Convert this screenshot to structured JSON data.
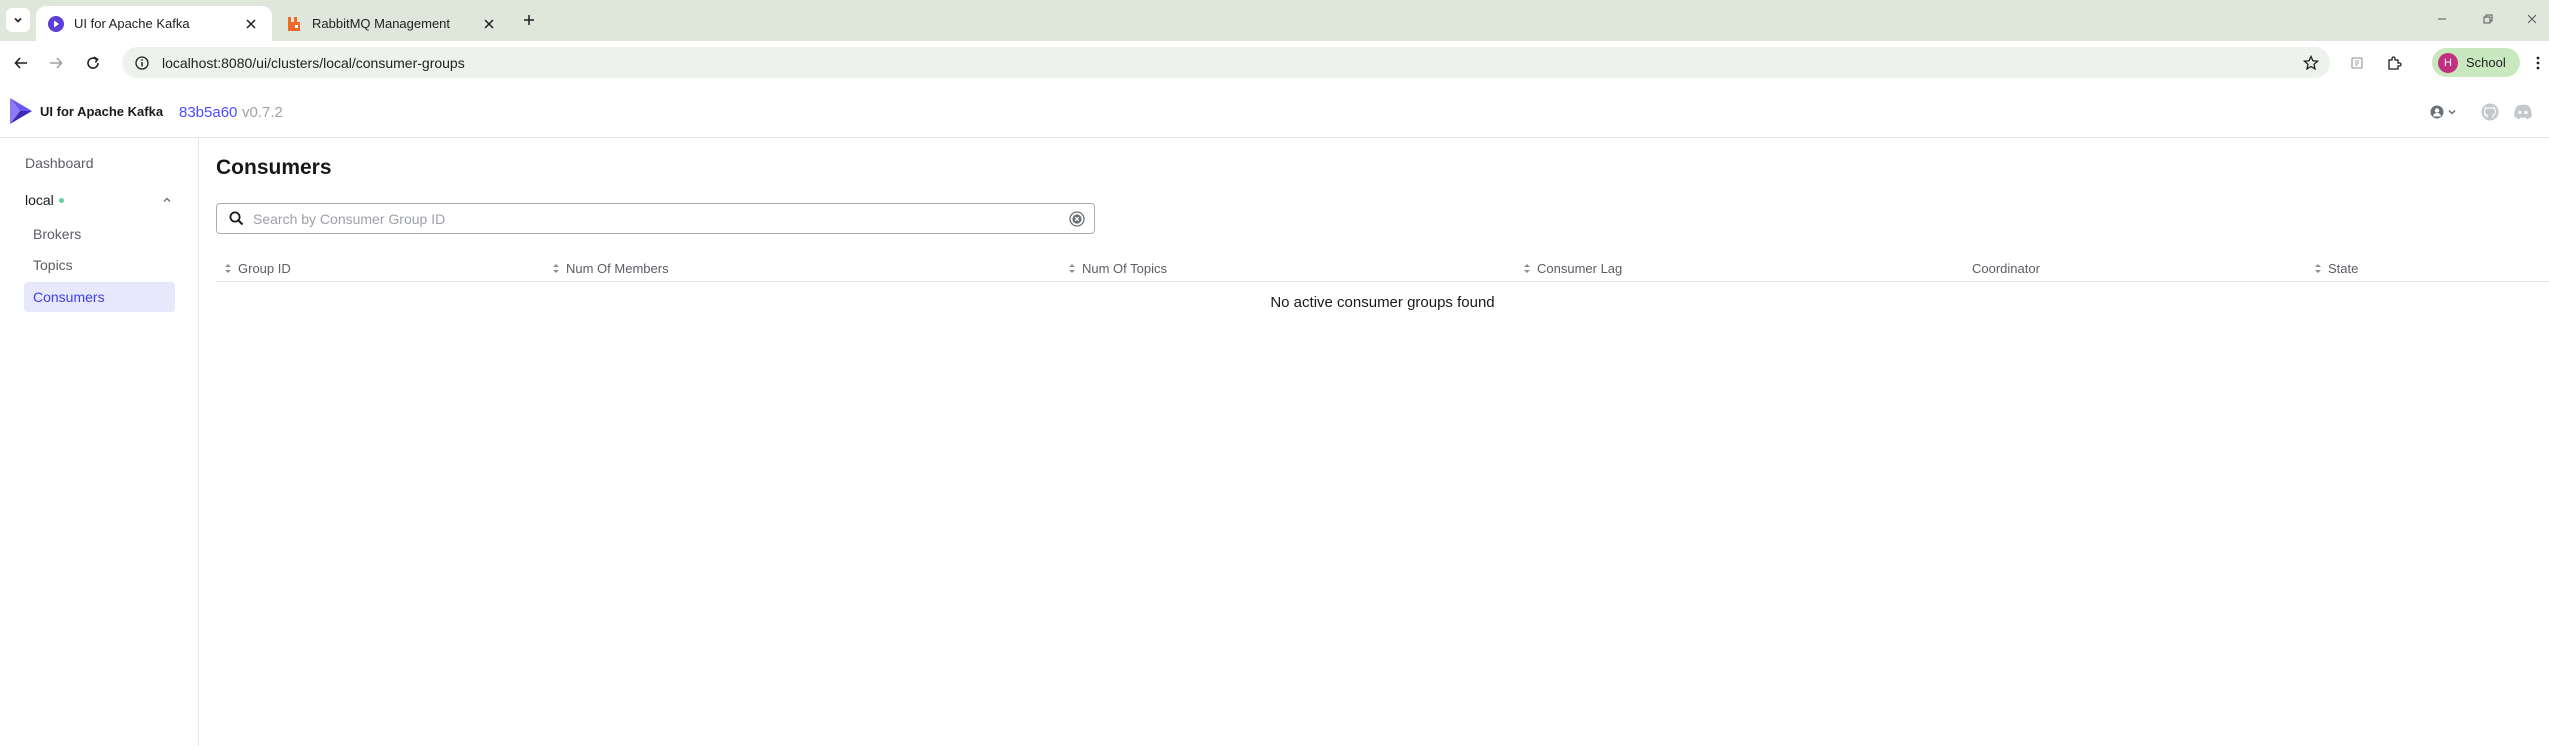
{
  "browser": {
    "tabs": [
      {
        "title": "UI for Apache Kafka",
        "active": true,
        "favicon": "kafka-ui-icon"
      },
      {
        "title": "RabbitMQ Management",
        "active": false,
        "favicon": "rabbitmq-icon"
      }
    ],
    "url": "localhost:8080/ui/clusters/local/consumer-groups",
    "profile": {
      "initial": "H",
      "name": "School",
      "color": "#c0307f"
    }
  },
  "header": {
    "brand": "UI for Apache Kafka",
    "version_hash": "83b5a60",
    "version": "v0.7.2",
    "icons": [
      "user-icon",
      "github-icon",
      "discord-icon"
    ]
  },
  "sidebar": {
    "dashboard": "Dashboard",
    "cluster": {
      "name": "local",
      "status_color": "#5ad498"
    },
    "items": [
      {
        "label": "Brokers",
        "active": false
      },
      {
        "label": "Topics",
        "active": false
      },
      {
        "label": "Consumers",
        "active": true
      }
    ]
  },
  "main": {
    "title": "Consumers",
    "search": {
      "placeholder": "Search by Consumer Group ID",
      "value": ""
    },
    "table": {
      "columns": [
        {
          "label": "Group ID",
          "sortable": true
        },
        {
          "label": "Num Of Members",
          "sortable": true
        },
        {
          "label": "Num Of Topics",
          "sortable": true
        },
        {
          "label": "Consumer Lag",
          "sortable": true
        },
        {
          "label": "Coordinator",
          "sortable": false
        },
        {
          "label": "State",
          "sortable": true
        }
      ],
      "empty_message": "No active consumer groups found"
    }
  },
  "colors": {
    "accent": "#4c4cff",
    "active_bg": "#e8e8fc",
    "chrome_bg": "#dfe7db"
  }
}
